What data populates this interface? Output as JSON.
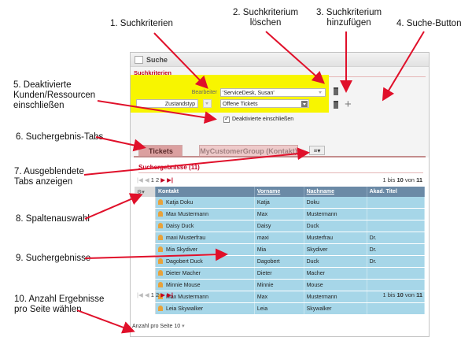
{
  "callouts": {
    "c1": "1. Suchkriterien",
    "c2_line1": "2. Suchkriterium",
    "c2_line2": "löschen",
    "c3_line1": "3. Suchkriterium",
    "c3_line2": "hinzufügen",
    "c4": "4. Suche-Button",
    "c5_line1": "5. Deaktivierte",
    "c5_line2": "Kunden/Ressourcen",
    "c5_line3": "einschließen",
    "c6": "6. Suchergebnis-Tabs",
    "c7_line1": "7. Ausgeblendete",
    "c7_line2": "Tabs anzeigen",
    "c8": "8. Spaltenauswahl",
    "c9": "9. Suchergebnisse",
    "c10_line1": "10. Anzahl Ergebnisse",
    "c10_line2": "pro Seite wählen"
  },
  "panel": {
    "title": "Suche",
    "criteria_title": "Suchkriterien",
    "field1_label": "Bearbeiter",
    "field1_value": "'ServiceDesk, Susan'",
    "field2_label": "Zustandstyp",
    "field2_value": "Offene Tickets",
    "checkbox_label": "Deaktivierte einschließen",
    "search_button": "Suche",
    "plus_symbol": "+"
  },
  "tabs": {
    "tab1": "Tickets",
    "tab2": "MyCustomerGroup (Kontakt)",
    "menu_symbol": "≡▾"
  },
  "results": {
    "title": "Suchergebnisse (11)",
    "pager_pages": "1 2",
    "count_prefix": "1 bis",
    "count_mid": "10",
    "count_of": "von",
    "count_total": "11",
    "columns": [
      "Kontakt",
      "Vorname",
      "Nachname",
      "Akad. Titel"
    ],
    "rows": [
      {
        "kontakt": "Katja Doku",
        "vorname": "Katja",
        "nachname": "Doku",
        "titel": ""
      },
      {
        "kontakt": "Max Mustermann",
        "vorname": "Max",
        "nachname": "Mustermann",
        "titel": ""
      },
      {
        "kontakt": "Daisy Duck",
        "vorname": "Daisy",
        "nachname": "Duck",
        "titel": ""
      },
      {
        "kontakt": "maxi Musterfrau",
        "vorname": "maxi",
        "nachname": "Musterfrau",
        "titel": "Dr."
      },
      {
        "kontakt": "Mia Skydiver",
        "vorname": "Mia",
        "nachname": "Skydiver",
        "titel": "Dr."
      },
      {
        "kontakt": "Dagobert Duck",
        "vorname": "Dagobert",
        "nachname": "Duck",
        "titel": "Dr."
      },
      {
        "kontakt": "Dieter Macher",
        "vorname": "Dieter",
        "nachname": "Macher",
        "titel": ""
      },
      {
        "kontakt": "Minnie Mouse",
        "vorname": "Minnie",
        "nachname": "Mouse",
        "titel": ""
      },
      {
        "kontakt": "Max Mustermann",
        "vorname": "Max",
        "nachname": "Mustermann",
        "titel": ""
      },
      {
        "kontakt": "Leia Skywalker",
        "vorname": "Leia",
        "nachname": "Skywalker",
        "titel": ""
      }
    ],
    "per_page_label": "Anzahl pro Seite",
    "per_page_value": "10"
  },
  "colors": {
    "highlight": "#f8f500",
    "arrow": "#e0102a",
    "accent": "#c00020",
    "row": "#a6d6e8",
    "header": "#6b8aa6"
  }
}
